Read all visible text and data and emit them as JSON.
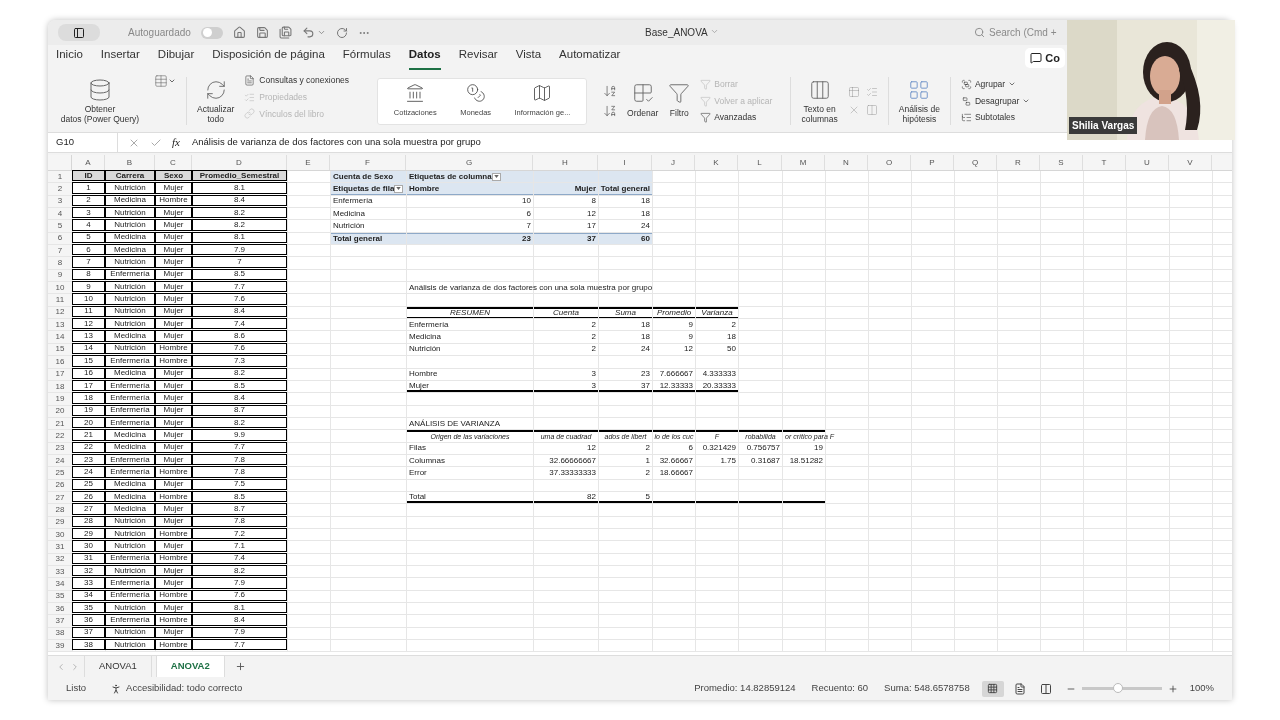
{
  "title_bar": {
    "autosave_label": "Autoguardado",
    "autosave_on": false,
    "file_name": "Base_ANOVA",
    "search_placeholder": "Search (Cmd +"
  },
  "ribbon_tabs": [
    {
      "label": "Inicio",
      "selected": false
    },
    {
      "label": "Insertar",
      "selected": false
    },
    {
      "label": "Dibujar",
      "selected": false
    },
    {
      "label": "Disposición de página",
      "selected": false
    },
    {
      "label": "Fórmulas",
      "selected": false
    },
    {
      "label": "Datos",
      "selected": true
    },
    {
      "label": "Revisar",
      "selected": false
    },
    {
      "label": "Vista",
      "selected": false
    },
    {
      "label": "Automatizar",
      "selected": false
    }
  ],
  "comments_button": "Co",
  "ribbon": {
    "get_data": [
      "Obtener",
      "datos (Power Query)"
    ],
    "refresh": [
      "Actualizar",
      "todo"
    ],
    "queries": [
      {
        "label": "Consultas y conexiones",
        "disabled": false
      },
      {
        "label": "Propiedades",
        "disabled": true
      },
      {
        "label": "Vínculos del libro",
        "disabled": true
      }
    ],
    "data_types": [
      "Cotizaciones",
      "Monedas",
      "Información ge..."
    ],
    "sort": "Ordenar",
    "filter": "Filtro",
    "filter_options": [
      {
        "label": "Borrar",
        "disabled": true
      },
      {
        "label": "Volver a aplicar",
        "disabled": true
      },
      {
        "label": "Avanzadas",
        "disabled": false
      }
    ],
    "text_to_columns": [
      "Texto en",
      "columnas"
    ],
    "what_if": [
      "Análisis de",
      "hipótesis"
    ],
    "outline": [
      {
        "label": "Agrupar",
        "dropdown": true
      },
      {
        "label": "Desagrupar",
        "dropdown": true
      },
      {
        "label": "Subtotales",
        "dropdown": false
      }
    ]
  },
  "formula_bar": {
    "cell_ref": "G10",
    "function_label": "fx",
    "formula": "Análisis de varianza de dos factores con una sola muestra por grupo"
  },
  "video": {
    "participant": "Shilia Vargas"
  },
  "sheet": {
    "column_letters": [
      "A",
      "B",
      "C",
      "D",
      "E",
      "F",
      "G",
      "H",
      "I",
      "J",
      "K",
      "L",
      "M",
      "N",
      "O",
      "P",
      "Q",
      "R",
      "S",
      "T",
      "U",
      "V"
    ],
    "row_numbers": [
      "1",
      "2",
      "3",
      "4",
      "5",
      "6",
      "7",
      "8",
      "9",
      "10",
      "11",
      "12",
      "13",
      "14",
      "15",
      "16",
      "17",
      "18",
      "19",
      "20",
      "21",
      "22",
      "23",
      "24",
      "25",
      "26",
      "27",
      "28",
      "29",
      "30",
      "31",
      "32",
      "33",
      "34",
      "35",
      "36",
      "37",
      "38",
      "39"
    ],
    "data_table": {
      "columns": [
        "ID",
        "Carrera",
        "Sexo",
        "Promedio_Semestral"
      ],
      "rows": [
        [
          "1",
          "Nutrición",
          "Mujer",
          "8.1"
        ],
        [
          "2",
          "Medicina",
          "Hombre",
          "8.4"
        ],
        [
          "3",
          "Nutrición",
          "Mujer",
          "8.2"
        ],
        [
          "4",
          "Nutrición",
          "Mujer",
          "8.2"
        ],
        [
          "5",
          "Medicina",
          "Mujer",
          "8.1"
        ],
        [
          "6",
          "Medicina",
          "Mujer",
          "7.9"
        ],
        [
          "7",
          "Nutrición",
          "Mujer",
          "7"
        ],
        [
          "8",
          "Enfermería",
          "Mujer",
          "8.5"
        ],
        [
          "9",
          "Nutrición",
          "Mujer",
          "7.7"
        ],
        [
          "10",
          "Nutrición",
          "Mujer",
          "7.6"
        ],
        [
          "11",
          "Nutrición",
          "Mujer",
          "8.4"
        ],
        [
          "12",
          "Nutrición",
          "Mujer",
          "7.4"
        ],
        [
          "13",
          "Medicina",
          "Mujer",
          "8.6"
        ],
        [
          "14",
          "Nutrición",
          "Hombre",
          "7.6"
        ],
        [
          "15",
          "Enfermería",
          "Hombre",
          "7.3"
        ],
        [
          "16",
          "Medicina",
          "Mujer",
          "8.2"
        ],
        [
          "17",
          "Enfermería",
          "Mujer",
          "8.5"
        ],
        [
          "18",
          "Enfermería",
          "Mujer",
          "8.4"
        ],
        [
          "19",
          "Enfermería",
          "Mujer",
          "8.7"
        ],
        [
          "20",
          "Enfermería",
          "Mujer",
          "8.2"
        ],
        [
          "21",
          "Medicina",
          "Mujer",
          "9.9"
        ],
        [
          "22",
          "Medicina",
          "Mujer",
          "7.7"
        ],
        [
          "23",
          "Enfermería",
          "Mujer",
          "7.8"
        ],
        [
          "24",
          "Enfermería",
          "Hombre",
          "7.8"
        ],
        [
          "25",
          "Medicina",
          "Mujer",
          "7.5"
        ],
        [
          "26",
          "Medicina",
          "Hombre",
          "8.5"
        ],
        [
          "27",
          "Medicina",
          "Mujer",
          "8.7"
        ],
        [
          "28",
          "Nutrición",
          "Mujer",
          "7.8"
        ],
        [
          "29",
          "Nutrición",
          "Hombre",
          "7.2"
        ],
        [
          "30",
          "Nutrición",
          "Mujer",
          "7.1"
        ],
        [
          "31",
          "Enfermería",
          "Hombre",
          "7.4"
        ],
        [
          "32",
          "Nutrición",
          "Mujer",
          "8.2"
        ],
        [
          "33",
          "Enfermería",
          "Mujer",
          "7.9"
        ],
        [
          "34",
          "Enfermería",
          "Hombre",
          "7.6"
        ],
        [
          "35",
          "Nutrición",
          "Mujer",
          "8.1"
        ],
        [
          "36",
          "Enfermería",
          "Hombre",
          "8.4"
        ],
        [
          "37",
          "Nutrición",
          "Mujer",
          "7.9"
        ],
        [
          "38",
          "Nutrición",
          "Hombre",
          "7.7"
        ]
      ]
    },
    "pivot_table": {
      "corner": "Cuenta de Sexo",
      "column_caption": "Etiquetas de columna",
      "row_caption": "Etiquetas de fila",
      "columns": [
        "Hombre",
        "Mujer",
        "Total general"
      ],
      "rows": [
        {
          "label": "Enfermería",
          "values": [
            "10",
            "8",
            "18"
          ]
        },
        {
          "label": "Medicina",
          "values": [
            "6",
            "12",
            "18"
          ]
        },
        {
          "label": "Nutrición",
          "values": [
            "7",
            "17",
            "24"
          ]
        }
      ],
      "total": {
        "label": "Total general",
        "values": [
          "23",
          "37",
          "60"
        ]
      }
    },
    "anova": {
      "title": "Análisis de varianza de dos factores con una sola muestra por grupo",
      "summary_headers": [
        "RESUMEN",
        "Cuenta",
        "Suma",
        "Promedio",
        "Varianza"
      ],
      "summary_rows": [
        [
          "Enfermería",
          "2",
          "18",
          "9",
          "2"
        ],
        [
          "Medicina",
          "2",
          "18",
          "9",
          "18"
        ],
        [
          "Nutrición",
          "2",
          "24",
          "12",
          "50"
        ]
      ],
      "summary_rows_2": [
        [
          "Hombre",
          "3",
          "23",
          "7.666667",
          "4.333333"
        ],
        [
          "Mujer",
          "3",
          "37",
          "12.33333",
          "20.33333"
        ]
      ],
      "table_title": "ANÁLISIS DE VARIANZA",
      "table_headers": [
        "Origen de las variaciones",
        "uma de cuadrad",
        "ados de libert",
        "io de los cuc",
        "F",
        "robabilida",
        "or crítico para F"
      ],
      "table_rows": [
        [
          "Filas",
          "12",
          "2",
          "6",
          "0.321429",
          "0.756757",
          "19"
        ],
        [
          "Columnas",
          "32.66666667",
          "1",
          "32.66667",
          "1.75",
          "0.31687",
          "18.51282"
        ],
        [
          "Error",
          "37.33333333",
          "2",
          "18.66667"
        ]
      ],
      "total_row": [
        "Total",
        "82",
        "5"
      ]
    }
  },
  "sheet_tabs": [
    {
      "label": "ANOVA1",
      "selected": false
    },
    {
      "label": "ANOVA2",
      "selected": true
    }
  ],
  "status_bar": {
    "status": "Listo",
    "accessibility": "Accesibilidad: todo correcto",
    "average": "Promedio: 14.82859124",
    "count": "Recuento: 60",
    "sum": "Suma: 548.6578758",
    "level": 0.45,
    "zoom": "100%"
  }
}
